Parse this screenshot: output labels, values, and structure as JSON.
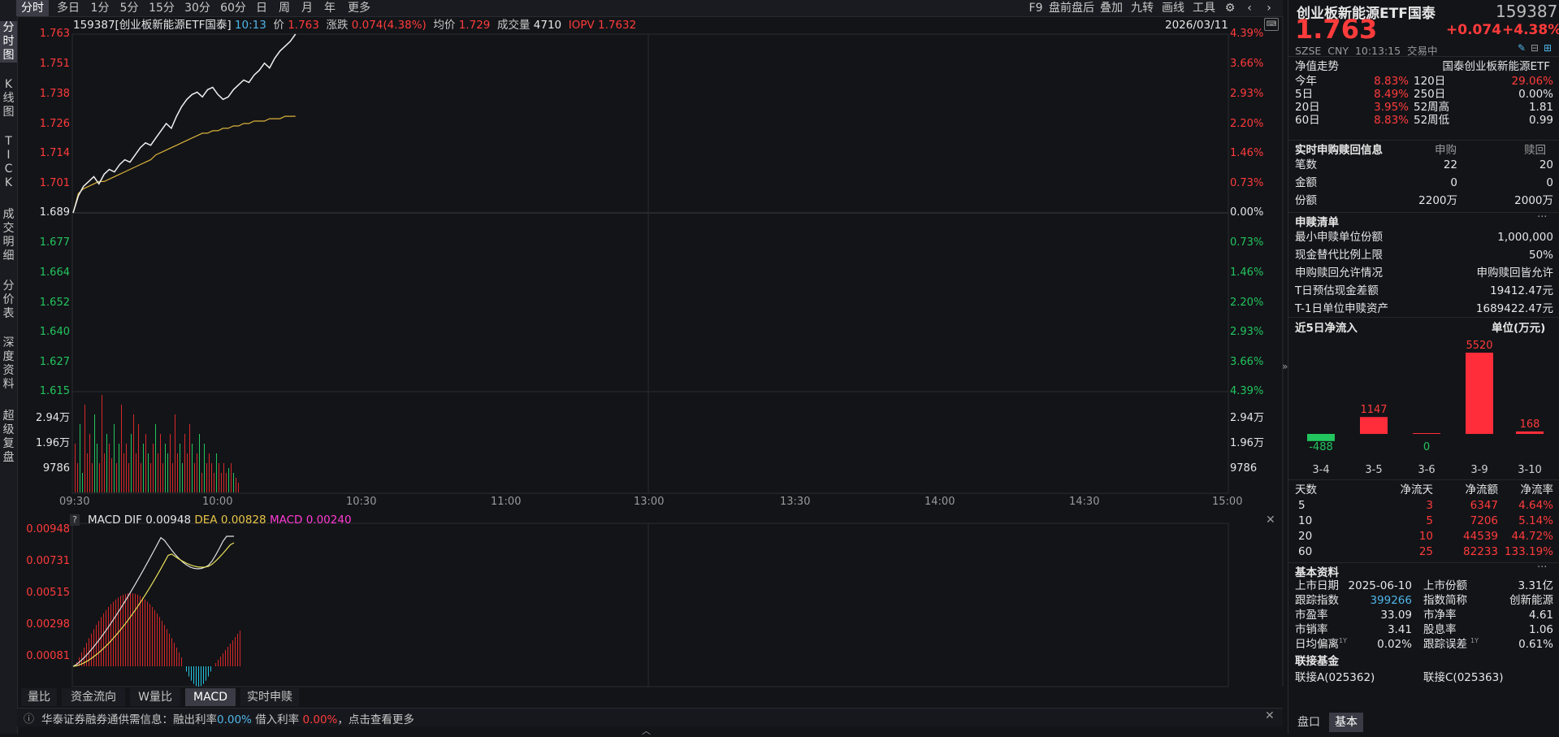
{
  "toolbar": {
    "periods": [
      "分时",
      "多日",
      "1分",
      "5分",
      "15分",
      "30分",
      "60分",
      "日",
      "周",
      "月",
      "年",
      "更多"
    ],
    "right_items": [
      "F9",
      "盘前盘后",
      "叠加",
      "九转",
      "画线",
      "工具"
    ]
  },
  "left_tabs": [
    "分时图",
    "K线图",
    "TICK",
    "成交明细",
    "分价表",
    "深度资料",
    "超级复盘"
  ],
  "info": {
    "code_name": "159387[创业板新能源ETF国泰]",
    "time": "10:13",
    "price_label": "价",
    "price": "1.763",
    "change_label": "涨跌",
    "change": "0.074(4.38%)",
    "avg_label": "均价",
    "avg": "1.729",
    "vol_label": "成交量",
    "vol": "4710",
    "iopv_label": "IOPV",
    "iopv": "1.7632",
    "date": "2026/03/11"
  },
  "price_axis": {
    "left": [
      "1.763",
      "1.751",
      "1.738",
      "1.726",
      "1.714",
      "1.701",
      "1.689",
      "1.677",
      "1.664",
      "1.652",
      "1.640",
      "1.627",
      "1.615"
    ],
    "right": [
      "4.39%",
      "3.66%",
      "2.93%",
      "2.20%",
      "1.46%",
      "0.73%",
      "0.00%",
      "0.73%",
      "1.46%",
      "2.20%",
      "2.93%",
      "3.66%",
      "4.39%"
    ]
  },
  "volume_axis": [
    "2.94万",
    "1.96万",
    "9786"
  ],
  "time_axis": [
    "09:30",
    "10:00",
    "10:30",
    "11:00",
    "13:00",
    "13:30",
    "14:00",
    "14:30",
    "15:00"
  ],
  "macd": {
    "title": "MACD",
    "dif_label": "DIF",
    "dif": "0.00948",
    "dea_label": "DEA",
    "dea": "0.00828",
    "macd_label": "MACD",
    "macd": "0.00240",
    "axis": [
      "0.00948",
      "0.00731",
      "0.00515",
      "0.00298",
      "0.00081"
    ]
  },
  "bottom_tabs": [
    "量比",
    "资金流向",
    "W量比",
    "MACD",
    "实时申赎"
  ],
  "notice": {
    "text": "华泰证券融券通供需信息：融出利率",
    "rate1": "0.00%",
    "mid": "借入利率",
    "rate2": "0.00%",
    "tail": "，点击查看更多"
  },
  "panel": {
    "name": "创业板新能源ETF国泰",
    "code": "159387",
    "price": "1.763",
    "change": "+0.074",
    "pct": "+4.38%",
    "meta": "SZSE  CNY  10:13:15  交易中",
    "nav_title": "净值走势",
    "nav_fund": "国泰创业板新能源ETF",
    "nav_rows": [
      [
        "今年",
        "8.83%",
        "120日",
        "29.06%"
      ],
      [
        "5日",
        "8.49%",
        "250日",
        "0.00%"
      ],
      [
        "20日",
        "3.95%",
        "52周高",
        "1.81"
      ],
      [
        "60日",
        "8.83%",
        "52周低",
        "0.99"
      ]
    ],
    "sub_title": "实时申购赎回信息",
    "sub_cols": [
      "申购",
      "赎回"
    ],
    "sub_rows": [
      [
        "笔数",
        "22",
        "20"
      ],
      [
        "金额",
        "0",
        "0"
      ],
      [
        "份额",
        "2200万",
        "2000万"
      ]
    ],
    "list_title": "申赎清单",
    "list_rows": [
      [
        "最小申赎单位份额",
        "1,000,000"
      ],
      [
        "现金替代比例上限",
        "50%"
      ],
      [
        "申购赎回允许情况",
        "申购赎回皆允许"
      ],
      [
        "T日预估现金差额",
        "19412.47元"
      ],
      [
        "T-1日单位申赎资产",
        "1689422.47元"
      ]
    ],
    "flow_title": "近5日净流入",
    "flow_unit": "单位(万元)",
    "flow_chart": {
      "categories": [
        "3-4",
        "3-5",
        "3-6",
        "3-9",
        "3-10"
      ],
      "values": [
        -488,
        1147,
        0,
        5520,
        168
      ]
    },
    "flow_table_head": [
      "天数",
      "净流天",
      "净流额",
      "净流率"
    ],
    "flow_table": [
      [
        "5",
        "3",
        "6347",
        "4.64%"
      ],
      [
        "10",
        "5",
        "7206",
        "5.14%"
      ],
      [
        "20",
        "10",
        "44539",
        "44.72%"
      ],
      [
        "60",
        "25",
        "82233",
        "133.19%"
      ]
    ],
    "basic_title": "基本资料",
    "basic_rows": [
      [
        "上市日期",
        "2025-06-10",
        "上市份额",
        "3.31亿"
      ],
      [
        "跟踪指数",
        "399266",
        "指数简称",
        "创新能源"
      ],
      [
        "市盈率",
        "33.09",
        "市净率",
        "4.61"
      ],
      [
        "市销率",
        "3.41",
        "股息率",
        "1.06"
      ],
      [
        "日均偏离",
        "0.02%",
        "跟踪误差",
        "0.61%"
      ]
    ],
    "sup": "1Y",
    "link_title": "联接基金",
    "link_a": "联接A(025362)",
    "link_c": "联接C(025363)",
    "tabs": [
      "盘口",
      "基本"
    ],
    "more": "···"
  }
}
